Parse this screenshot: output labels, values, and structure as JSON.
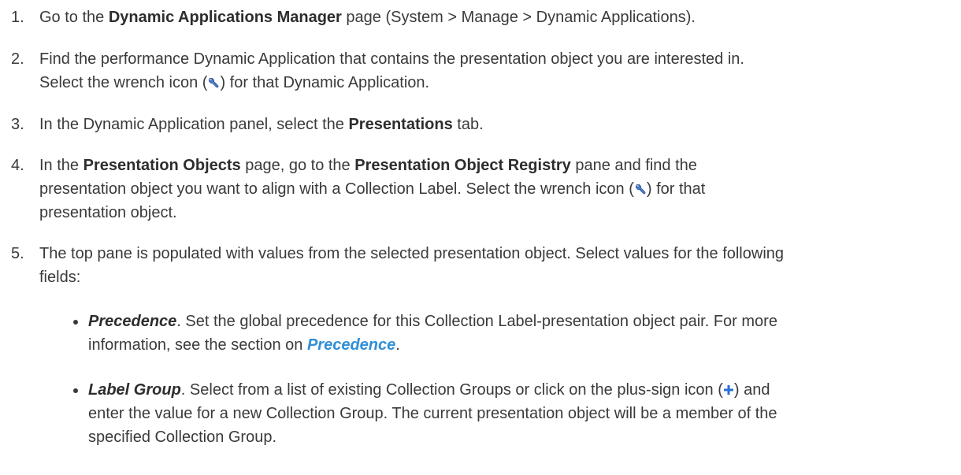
{
  "steps": [
    {
      "number": "1.",
      "parts": {
        "a": "Go to the ",
        "b": "Dynamic Applications Manager",
        "c": " page (System > Manage > Dynamic Applications)."
      }
    },
    {
      "number": "2.",
      "parts": {
        "a": "Find the performance Dynamic Application that contains the presentation object you are interested in.",
        "b": "Select the wrench icon (",
        "c": ") for that Dynamic Application."
      }
    },
    {
      "number": "3.",
      "parts": {
        "a": "In the Dynamic Application panel, select the ",
        "b": "Presentations",
        "c": " tab."
      }
    },
    {
      "number": "4.",
      "parts": {
        "a": "In the ",
        "b": "Presentation Objects",
        "c": " page, go to the ",
        "d": "Presentation Object Registry",
        "e": " pane and find the",
        "f": "presentation object you want to align with a Collection Label. Select the wrench icon (",
        "g": ") for that",
        "h": "presentation object."
      }
    },
    {
      "number": "5.",
      "parts": {
        "a": "The top pane is populated with values from the selected presentation object. Select values for the following",
        "b": "fields:"
      }
    }
  ],
  "bullets": [
    {
      "term": "Precedence",
      "parts": {
        "a": ". Set the global precedence for this Collection Label-presentation object pair. For more",
        "b": "information, see the section on ",
        "link": "Precedence",
        "c": "."
      }
    },
    {
      "term": "Label Group",
      "parts": {
        "a": ". Select from a list of existing Collection Groups or click on the plus-sign icon (",
        "b": ") and",
        "c": "enter the value for a new Collection Group. The current presentation object will be a member of the",
        "d": "specified Collection Group."
      }
    }
  ],
  "icons": {
    "wrench": "wrench-icon",
    "plus": "plus-icon"
  },
  "colors": {
    "text": "#3a3a3a",
    "link": "#2f8fd6",
    "wrench_blue": "#4a78c8",
    "plus_blue": "#2a6fd6"
  }
}
